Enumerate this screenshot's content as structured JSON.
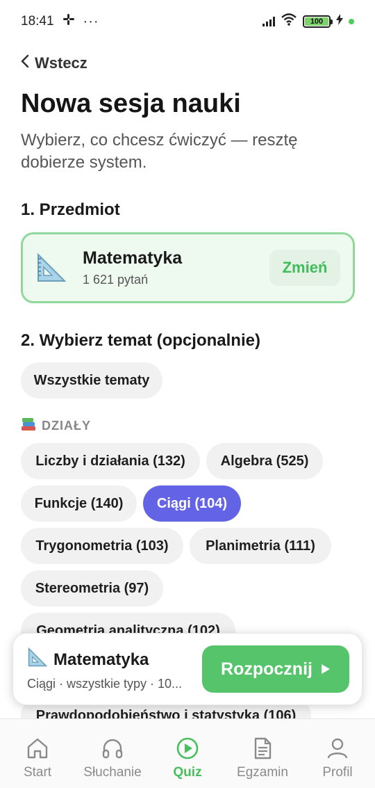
{
  "status": {
    "time": "18:41",
    "battery": "100"
  },
  "nav_back": {
    "label": "Wstecz"
  },
  "page": {
    "title": "Nowa sesja nauki",
    "subtitle": "Wybierz, co chcesz ćwiczyć — resztę dobierze system."
  },
  "subject_section": {
    "heading": "1. Przedmiot",
    "name": "Matematyka",
    "count": "1 621 pytań",
    "change_label": "Zmień",
    "icon": "set-square-icon"
  },
  "topic_section": {
    "heading": "2. Wybierz temat (opcjonalnie)",
    "all_label": "Wszystkie tematy",
    "category_label": "DZIAŁY",
    "category_icon": "books-icon",
    "topics": [
      "Liczby i działania (132)",
      "Algebra (525)",
      "Funkcje (140)",
      "Ciągi (104)",
      "Trygonometria (103)",
      "Planimetria (111)",
      "Stereometria (97)",
      "Geometria analityczna (102)",
      "Prawdopodobieństwo i statystyka (106)"
    ],
    "selected_topic": "Ciągi (104)"
  },
  "summary_bar": {
    "subject": "Matematyka",
    "details": "Ciągi · wszystkie typy · 10...",
    "start_label": "Rozpocznij"
  },
  "bottom_nav": {
    "items": [
      "Start",
      "Słuchanie",
      "Quiz",
      "Egzamin",
      "Profil"
    ],
    "active": "Quiz"
  },
  "colors": {
    "accent_green": "#56c46b",
    "selected_chip": "#6363e6",
    "subject_border": "#8fd89a"
  }
}
